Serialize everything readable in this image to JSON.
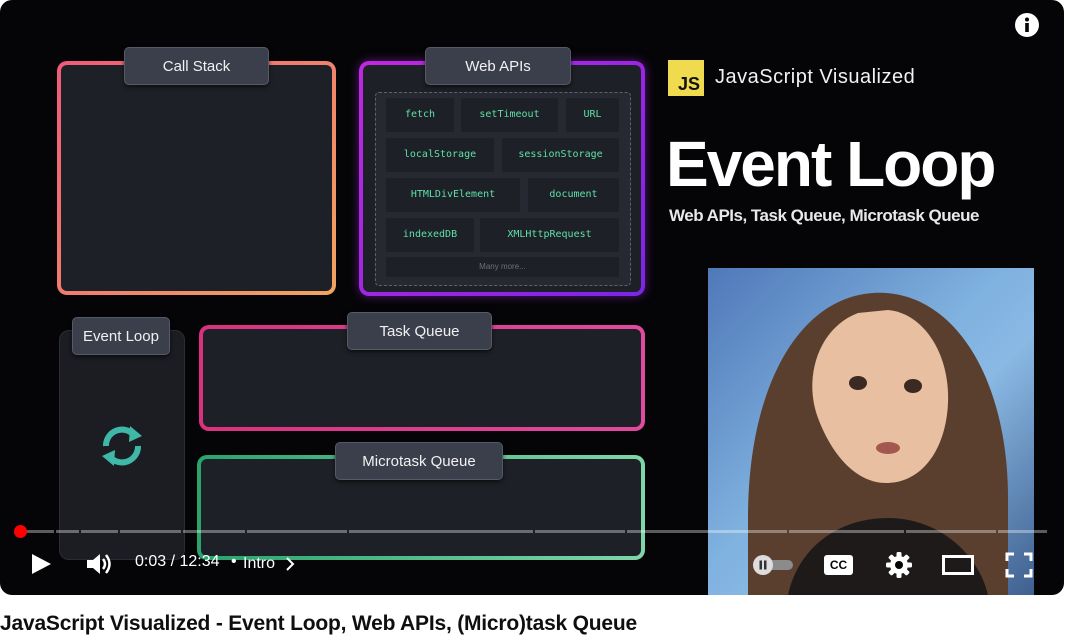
{
  "diagram": {
    "call_stack": "Call Stack",
    "web_apis": "Web APIs",
    "web_api_items": [
      "fetch",
      "setTimeout",
      "URL",
      "localStorage",
      "sessionStorage",
      "HTMLDivElement",
      "document",
      "indexedDB",
      "XMLHttpRequest",
      "Many more..."
    ],
    "event_loop": "Event Loop",
    "task_queue": "Task Queue",
    "microtask_queue": "Microtask Queue"
  },
  "branding": {
    "logo_text": "JS",
    "series": "JavaScript Visualized",
    "headline": "Event Loop",
    "subtitle": "Web APIs, Task Queue, Microtask Queue"
  },
  "player": {
    "time": "0:03 / 12:34",
    "separator": "•",
    "chapter": "Intro",
    "progress_fraction": 0.004,
    "accent_color": "#ff0000",
    "icons": [
      "info-icon",
      "play-icon",
      "volume-icon",
      "autoplay-toggle-icon",
      "captions-icon",
      "settings-icon",
      "theater-mode-icon",
      "fullscreen-icon"
    ],
    "captions_label": "CC"
  },
  "video_title": "JavaScript Visualized - Event Loop, Web APIs, (Micro)task Queue"
}
